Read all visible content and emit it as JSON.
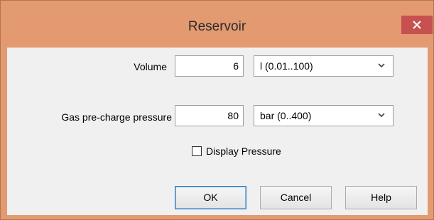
{
  "window": {
    "title": "Reservoir",
    "close_label": "×"
  },
  "form": {
    "volume": {
      "label": "Volume",
      "value": "6",
      "unit": "l  (0.01..100)"
    },
    "gas_pressure": {
      "label": "Gas pre-charge pressure",
      "value": "80",
      "unit": "bar  (0..400)"
    },
    "display_pressure": {
      "label": "Display Pressure",
      "checked": false
    }
  },
  "buttons": {
    "ok": "OK",
    "cancel": "Cancel",
    "help": "Help"
  },
  "colors": {
    "titlebar": "#e39a70",
    "close": "#c75050",
    "client": "#f0f0f0"
  }
}
